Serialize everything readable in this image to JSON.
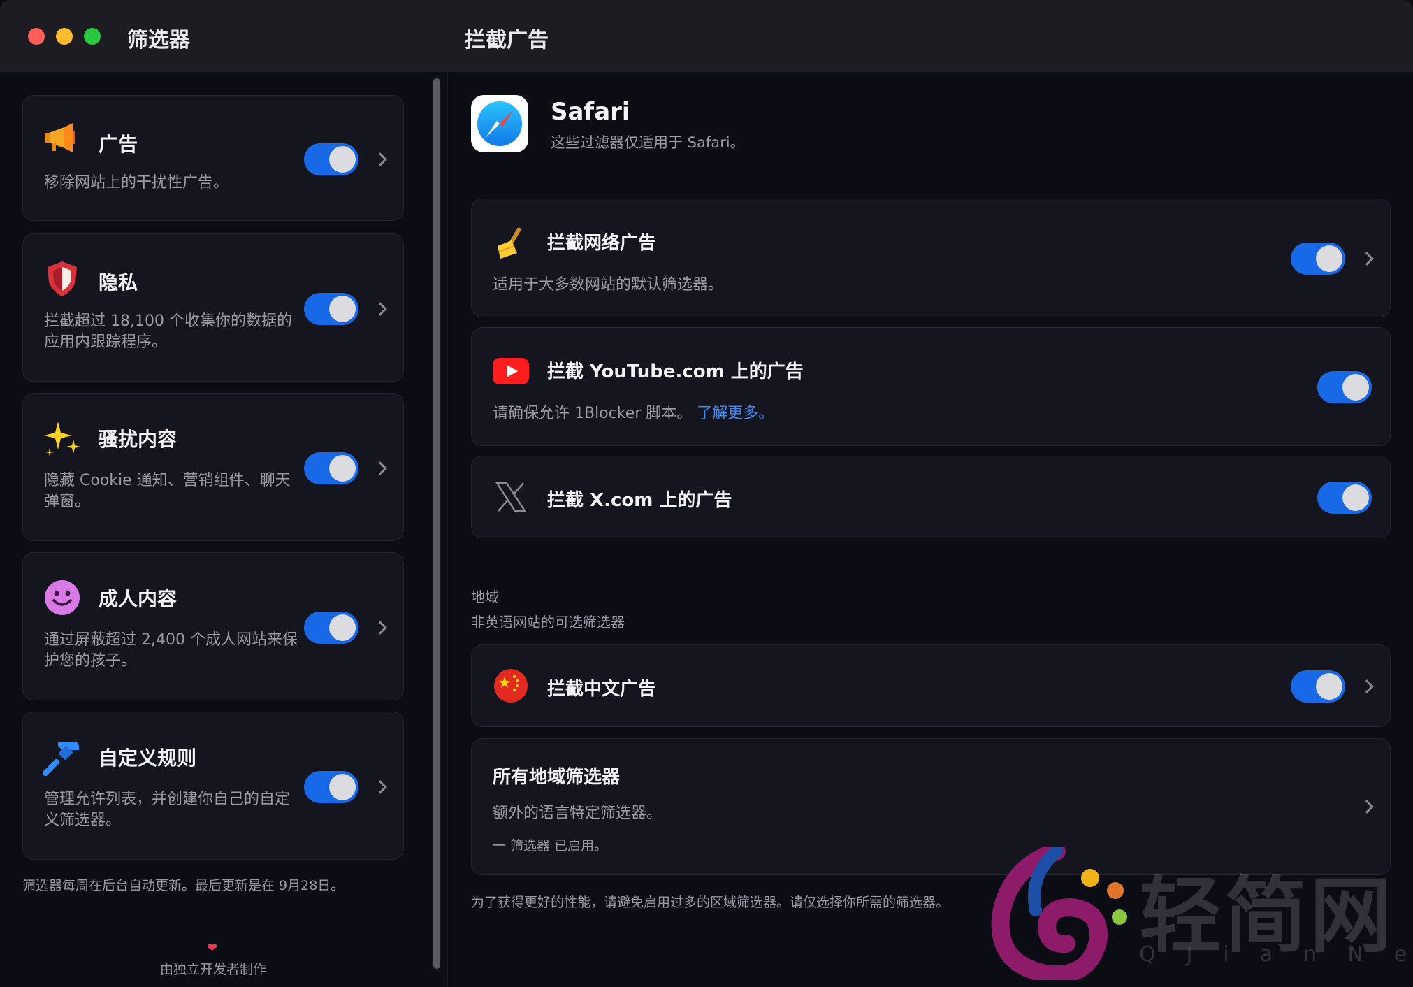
{
  "titlebar": {
    "sidebar_title": "筛选器",
    "main_title": "拦截广告"
  },
  "sidebar": {
    "cards": [
      {
        "title": "广告",
        "desc": "移除网站上的干扰性广告。",
        "icon": "megaphone-icon",
        "enabled": true
      },
      {
        "title": "隐私",
        "desc": "拦截超过 18,100 个收集你的数据的应用内跟踪程序。",
        "icon": "shield-icon",
        "enabled": true
      },
      {
        "title": "骚扰内容",
        "desc": "隐藏 Cookie 通知、营销组件、聊天弹窗。",
        "icon": "sparkles-icon",
        "enabled": true
      },
      {
        "title": "成人内容",
        "desc": "通过屏蔽超过 2,400 个成人网站来保护您的孩子。",
        "icon": "smiley-icon",
        "enabled": true
      },
      {
        "title": "自定义规则",
        "desc": "管理允许列表，并创建你自己的自定义筛选器。",
        "icon": "hammer-icon",
        "enabled": true
      }
    ],
    "footer": "筛选器每周在后台自动更新。最后更新是在 9月28日。",
    "made_by": "由独立开发者制作"
  },
  "main": {
    "safari": {
      "name": "Safari",
      "desc": "这些过滤器仅适用于 Safari。"
    },
    "filters": [
      {
        "title": "拦截网络广告",
        "desc": "适用于大多数网站的默认筛选器。",
        "icon": "broom-icon",
        "enabled": true
      },
      {
        "title": "拦截 YouTube.com 上的广告",
        "desc": "请确保允许 1Blocker 脚本。",
        "link": "了解更多。",
        "icon": "youtube-icon",
        "enabled": true
      },
      {
        "title": "拦截 X.com 上的广告",
        "icon": "x-logo-icon",
        "enabled": true
      }
    ],
    "region": {
      "label": "地域",
      "sublabel": "非英语网站的可选筛选器",
      "chinese": {
        "title": "拦截中文广告",
        "icon": "china-flag-icon",
        "enabled": true
      },
      "all": {
        "title": "所有地域筛选器",
        "desc": "额外的语言特定筛选器。",
        "status": "一 筛选器 已启用。"
      }
    },
    "footer": "为了获得更好的性能，请避免启用过多的区域筛选器。请仅选择你所需的筛选器。"
  },
  "watermark": {
    "text": "轻简网",
    "sub": "QJianNet"
  },
  "colors": {
    "accent": "#1769e8",
    "link": "#3d8bff",
    "background": "#0c0c14",
    "card": "#15151f"
  }
}
